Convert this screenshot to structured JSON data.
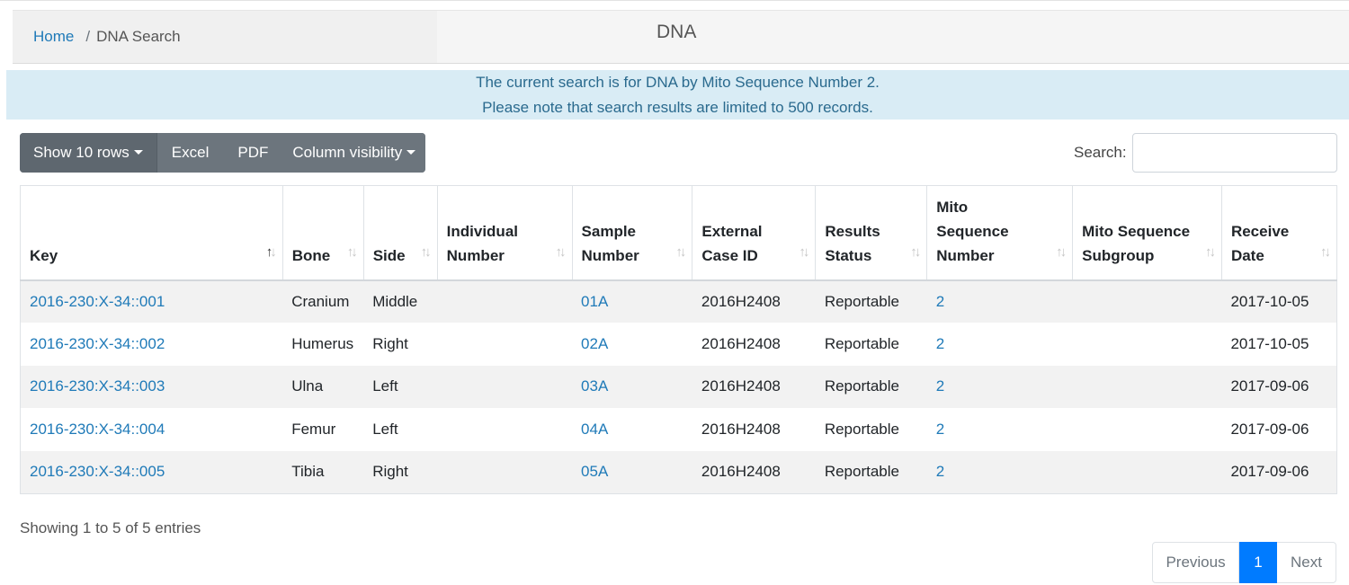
{
  "breadcrumb": {
    "home": "Home",
    "separator": "/",
    "current": "DNA Search"
  },
  "page_title": "DNA",
  "alert": {
    "line1": "The current search is for DNA by Mito Sequence Number 2.",
    "line2": "Please note that search results are limited to 500 records."
  },
  "toolbar": {
    "show_rows": "Show 10 rows",
    "excel": "Excel",
    "pdf": "PDF",
    "column_visibility": "Column visibility",
    "search_label": "Search:",
    "search_value": ""
  },
  "table": {
    "headers": [
      {
        "line1": "Key",
        "line2": "",
        "line3": ""
      },
      {
        "line1": "Bone",
        "line2": "",
        "line3": ""
      },
      {
        "line1": "Side",
        "line2": "",
        "line3": ""
      },
      {
        "line1": "Individual",
        "line2": "Number",
        "line3": ""
      },
      {
        "line1": "Sample",
        "line2": "Number",
        "line3": ""
      },
      {
        "line1": "External",
        "line2": "Case ID",
        "line3": ""
      },
      {
        "line1": "Results",
        "line2": "Status",
        "line3": ""
      },
      {
        "line1": "Mito",
        "line2": "Sequence",
        "line3": "Number"
      },
      {
        "line1": "Mito Sequence",
        "line2": "Subgroup",
        "line3": ""
      },
      {
        "line1": "Receive",
        "line2": "Date",
        "line3": ""
      }
    ],
    "rows": [
      {
        "key": "2016-230:X-34::001",
        "bone": "Cranium",
        "side": "Middle",
        "individual": "",
        "sample": "01A",
        "external": "2016H2408",
        "status": "Reportable",
        "mito": "2",
        "subgroup": "",
        "date": "2017-10-05"
      },
      {
        "key": "2016-230:X-34::002",
        "bone": "Humerus",
        "side": "Right",
        "individual": "",
        "sample": "02A",
        "external": "2016H2408",
        "status": "Reportable",
        "mito": "2",
        "subgroup": "",
        "date": "2017-10-05"
      },
      {
        "key": "2016-230:X-34::003",
        "bone": "Ulna",
        "side": "Left",
        "individual": "",
        "sample": "03A",
        "external": "2016H2408",
        "status": "Reportable",
        "mito": "2",
        "subgroup": "",
        "date": "2017-09-06"
      },
      {
        "key": "2016-230:X-34::004",
        "bone": "Femur",
        "side": "Left",
        "individual": "",
        "sample": "04A",
        "external": "2016H2408",
        "status": "Reportable",
        "mito": "2",
        "subgroup": "",
        "date": "2017-09-06"
      },
      {
        "key": "2016-230:X-34::005",
        "bone": "Tibia",
        "side": "Right",
        "individual": "",
        "sample": "05A",
        "external": "2016H2408",
        "status": "Reportable",
        "mito": "2",
        "subgroup": "",
        "date": "2017-09-06"
      }
    ]
  },
  "footer": {
    "info": "Showing 1 to 5 of 5 entries",
    "previous": "Previous",
    "current_page": "1",
    "next": "Next"
  },
  "colors": {
    "link": "#1f7ab8",
    "alert_bg": "#d9ecf5",
    "primary": "#007bff",
    "button": "#6c757d"
  }
}
